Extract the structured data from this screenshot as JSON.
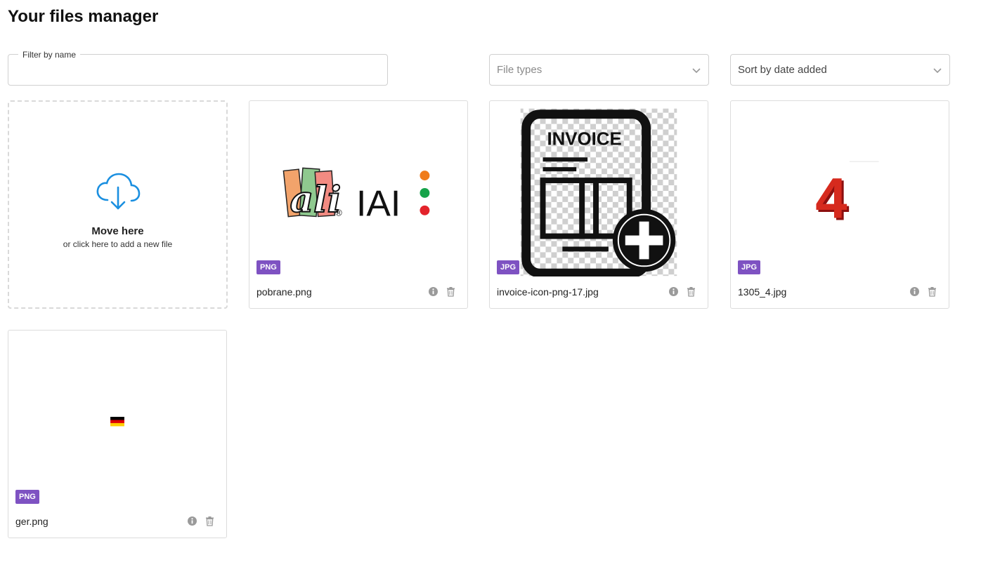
{
  "header": {
    "title": "Your files manager"
  },
  "filter": {
    "label": "Filter by name",
    "value": "",
    "placeholder": ""
  },
  "selects": {
    "file_types": {
      "value": "File types"
    },
    "sort": {
      "value": "Sort by date added"
    }
  },
  "dropzone": {
    "title": "Move here",
    "subtitle": "or click here to add a new file"
  },
  "thumbs": {
    "iai_logo_text": "IAI",
    "iai_registered": "®",
    "invoice_text": "INVOICE",
    "number_text": "4"
  },
  "files": [
    {
      "name": "pobrane.png",
      "type": "PNG"
    },
    {
      "name": "invoice-icon-png-17.jpg",
      "type": "JPG"
    },
    {
      "name": "1305_4.jpg",
      "type": "JPG"
    },
    {
      "name": "ger.png",
      "type": "PNG"
    }
  ],
  "colors": {
    "badge": "#7e52c2",
    "accent_blue": "#1a8fe0",
    "iai_orange": "#f07c1b",
    "iai_green": "#16a34a",
    "iai_red": "#e3232b"
  }
}
